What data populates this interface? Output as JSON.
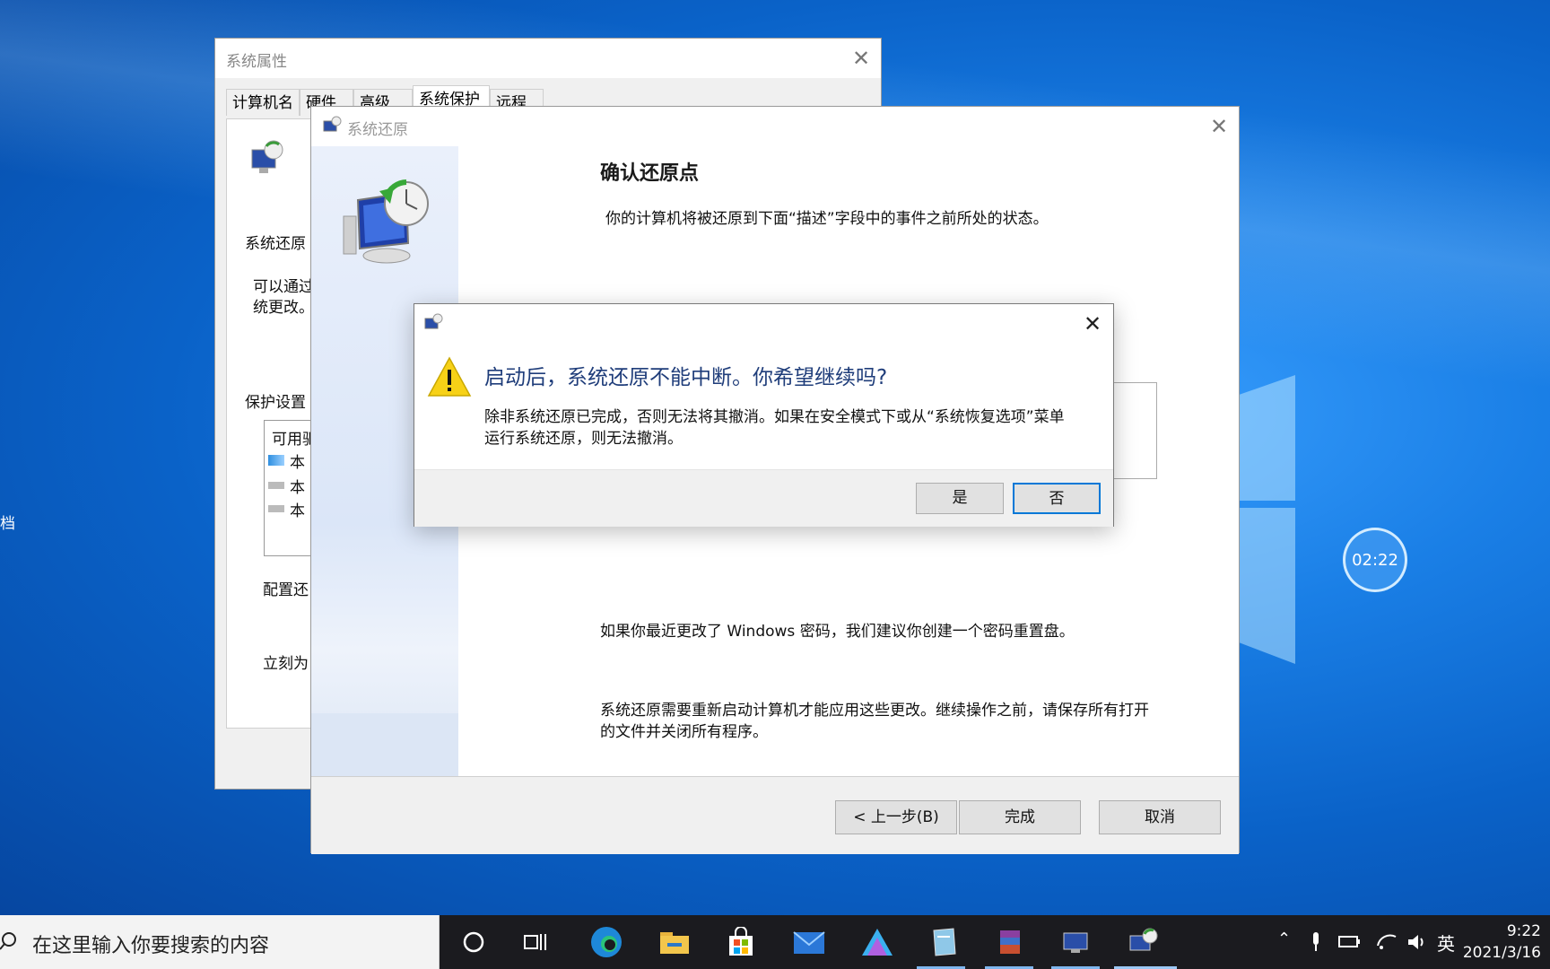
{
  "desktop": {
    "left_edge_text_1": "",
    "left_edge_text_2": "档",
    "timer": "02:22"
  },
  "sysprops": {
    "title": "系统属性",
    "tabs": [
      {
        "label": "计算机名"
      },
      {
        "label": "硬件"
      },
      {
        "label": "高级"
      },
      {
        "label": "系统保护"
      },
      {
        "label": "远程"
      }
    ],
    "restore_label": "系统还原",
    "restore_desc_1": "可以通过",
    "restore_desc_2": "统更改。",
    "protection_label": "保护设置",
    "list_header": "可用驱",
    "list_items": [
      {
        "label": "本"
      },
      {
        "label": "本"
      },
      {
        "label": "本"
      }
    ],
    "configure_label": "配置还",
    "create_label": "立刻为"
  },
  "restore": {
    "title": "系统还原",
    "heading": "确认还原点",
    "intro": "你的计算机将被还原到下面“描述”字段中的事件之前所处的状态。",
    "password_note": "如果你最近更改了 Windows 密码，我们建议你创建一个密码重置盘。",
    "restart_note_1": "系统还原需要重新启动计算机才能应用这些更改。继续操作之前，请保存所有打开",
    "restart_note_2": "的文件并关闭所有程序。",
    "back_label": "< 上一步(B)",
    "finish_label": "完成",
    "cancel_label": "取消"
  },
  "dialog": {
    "heading": "启动后，系统还原不能中断。你希望继续吗?",
    "body_1": "除非系统还原已完成，否则无法将其撤消。如果在安全模式下或从“系统恢复选项”菜单",
    "body_2": "运行系统还原，则无法撤消。",
    "yes_label": "是",
    "no_label": "否"
  },
  "taskbar": {
    "search_placeholder": "在这里输入你要搜索的内容",
    "ime": "英",
    "time": "9:22",
    "date": "2021/3/16"
  }
}
